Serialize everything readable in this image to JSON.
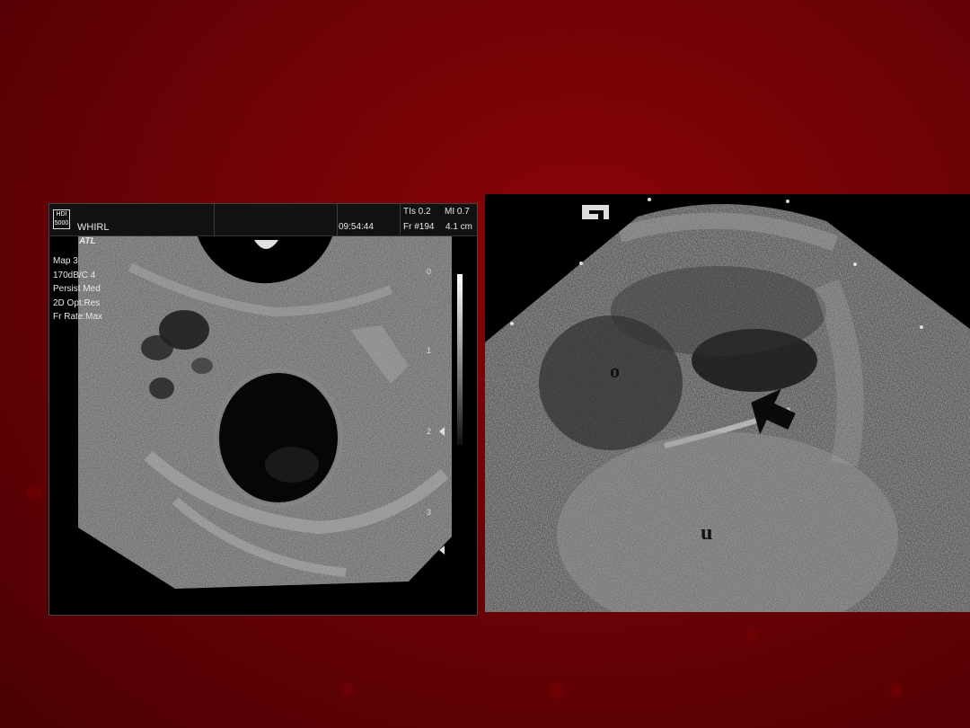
{
  "left_image": {
    "header": {
      "logo": "HDI 5000",
      "mode": "WHIRL",
      "brand": "ATL",
      "time": "09:54:44",
      "tis": "TIs 0.2",
      "mi": "MI 0.7",
      "frame": "Fr #194",
      "depth": "4.1 cm"
    },
    "params": [
      "Map 3",
      "170dB/C 4",
      "Persist Med",
      "2D Opt:Res",
      "Fr Rate:Max"
    ],
    "depth_ticks": [
      "0",
      "1",
      "2",
      "3"
    ]
  },
  "right_image": {
    "labels": {
      "ovary": "o",
      "uterus": "u"
    }
  },
  "colors": {
    "background": "#6e0206",
    "panel": "#000000",
    "scale_text": "#e8e8e8"
  }
}
